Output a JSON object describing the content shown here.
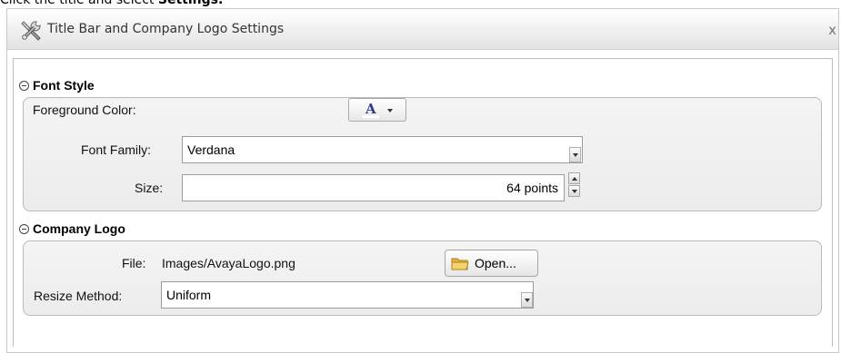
{
  "caption": {
    "prefix": "Click the title and select ",
    "bold": "Settings."
  },
  "dialog": {
    "title": "Title Bar and Company Logo Settings",
    "close": "x",
    "icon": "tools-icon"
  },
  "font_style": {
    "header": "Font Style",
    "foreground_color_label": "Foreground Color:",
    "foreground_color_glyph": "A",
    "font_family_label": "Font Family:",
    "font_family_value": "Verdana",
    "size_label": "Size:",
    "size_value": "64 points"
  },
  "company_logo": {
    "header": "Company Logo",
    "file_label": "File:",
    "file_value": "Images/AvayaLogo.png",
    "open_button": "Open...",
    "resize_label": "Resize Method:",
    "resize_value": "Uniform"
  },
  "colors": {
    "text_color_glyph": "#2a3f8f",
    "folder": "#f2c451"
  }
}
